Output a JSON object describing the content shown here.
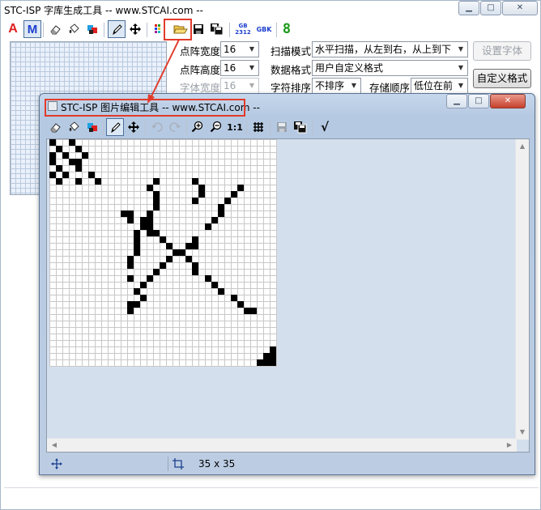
{
  "main_window": {
    "title": "STC-ISP 字库生成工具 -- www.STCAI.com --",
    "toolbar": {
      "font_a_label": "A",
      "font_m_label": "M",
      "gb2312_top": "GB",
      "gb2312_bottom": "2312",
      "gbk_label": "GBK",
      "digit_label": "8"
    },
    "settings": {
      "width_label": "点阵宽度",
      "width_value": "16",
      "height_label": "点阵高度",
      "height_value": "16",
      "font_width_label": "字体宽度",
      "font_width_value": "16",
      "scan_mode_label": "扫描模式",
      "scan_mode_value": "水平扫描，从左到右，从上到下",
      "data_format_label": "数据格式",
      "data_format_value": "用户自定义格式",
      "char_order_label": "字符排序",
      "char_order_value": "不排序",
      "storage_order_label": "存储顺序",
      "storage_order_value": "低位在前",
      "set_font_button": "设置字体",
      "custom_format_button": "自定义格式"
    }
  },
  "child_window": {
    "title": "STC-ISP 图片编辑工具 -- www.STCAI.com --",
    "toolbar": {
      "zoom_reset_label": "1:1",
      "apply_label": "√"
    },
    "status": {
      "size_text": "35 x 35"
    }
  },
  "colors": {
    "highlight": "#e23b2b",
    "digit_green": "#1a9a1a",
    "font_red": "#e02020",
    "font_blue": "#1c3fcf"
  }
}
